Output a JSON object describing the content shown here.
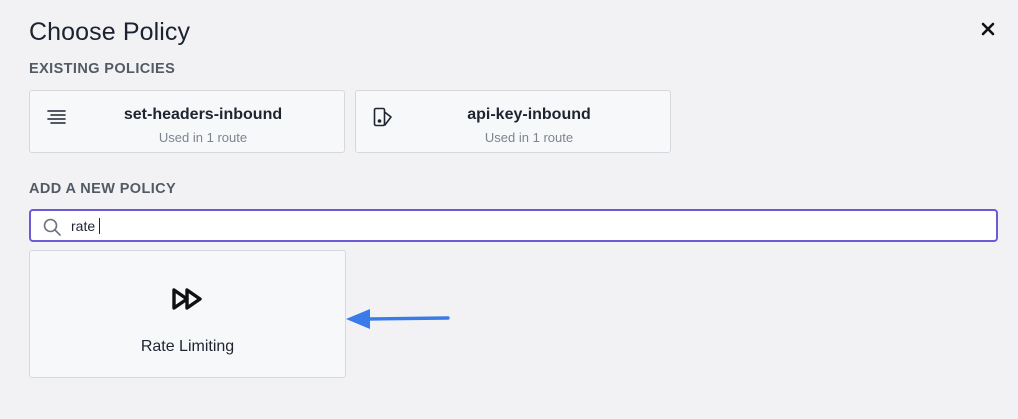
{
  "dialog": {
    "title": "Choose Policy",
    "close_icon": "close-icon"
  },
  "existing_section": {
    "label": "EXISTING POLICIES",
    "policies": [
      {
        "name": "set-headers-inbound",
        "usage": "Used in 1 route",
        "icon": "headers-lines-icon"
      },
      {
        "name": "api-key-inbound",
        "usage": "Used in 1 route",
        "icon": "api-key-icon"
      }
    ]
  },
  "new_section": {
    "label": "ADD A NEW POLICY",
    "search": {
      "value": "rate",
      "icon": "search-icon"
    },
    "results": [
      {
        "label": "Rate Limiting",
        "icon": "fast-forward-icon"
      }
    ]
  },
  "annotation": {
    "arrow_icon": "arrow-left-icon",
    "arrow_color": "#3a7bea"
  },
  "colors": {
    "focus_border": "#6b5bd6",
    "background": "#f2f2f4"
  }
}
